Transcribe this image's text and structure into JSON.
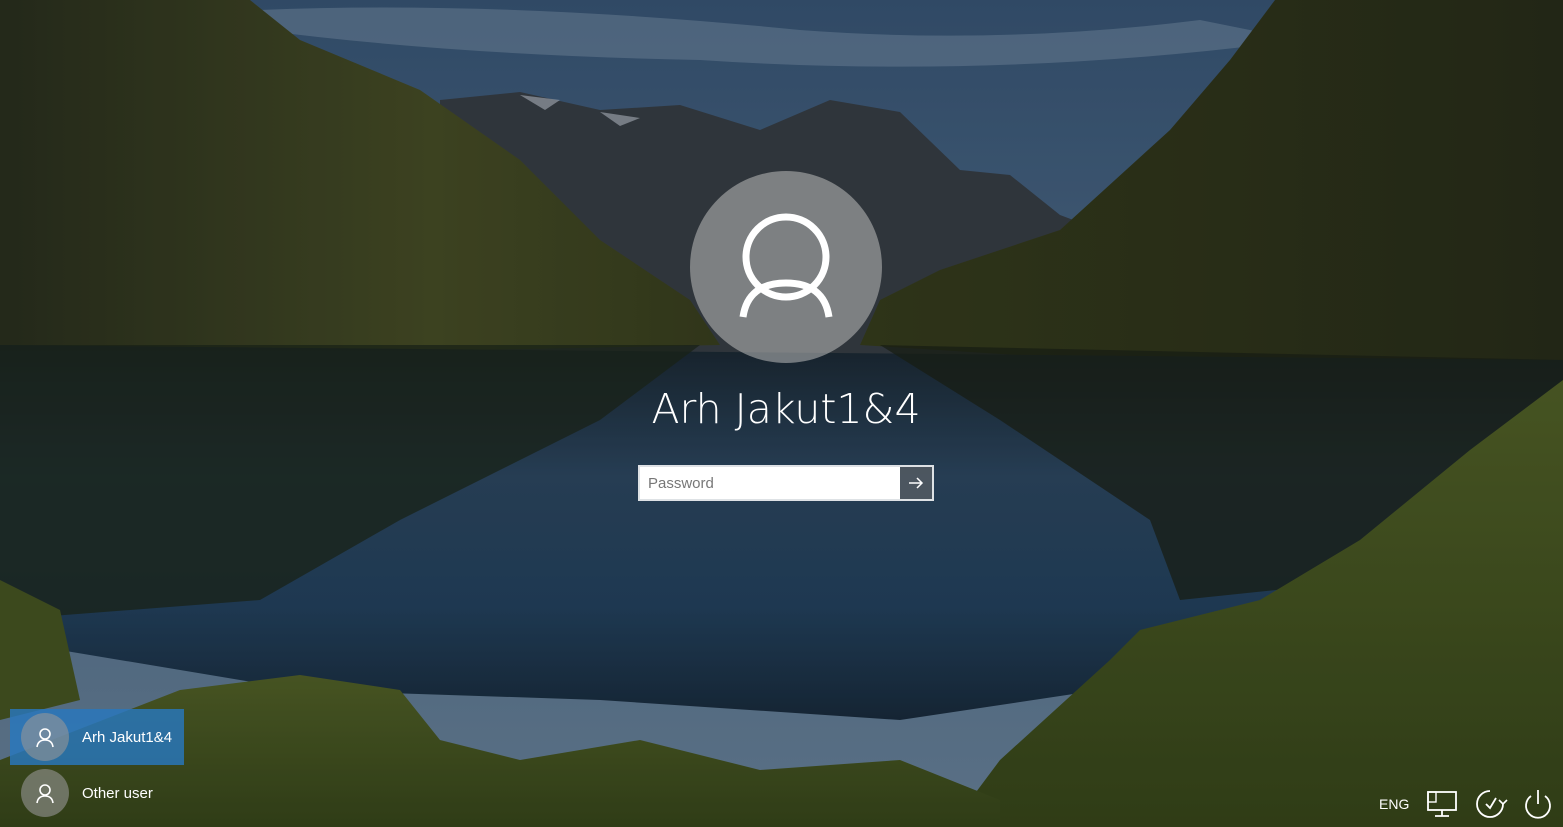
{
  "current_user": {
    "name": "Arh Jakut1&4",
    "avatar_icon": "user-icon"
  },
  "password": {
    "placeholder": "Password",
    "value": "",
    "submit_icon": "arrow-right-icon"
  },
  "user_list": [
    {
      "name": "Arh Jakut1&4",
      "selected": true,
      "icon": "user-icon"
    },
    {
      "name": "Other user",
      "selected": false,
      "icon": "user-icon"
    }
  ],
  "tray": {
    "language": "ENG",
    "network_icon": "network-icon",
    "accessibility_icon": "ease-of-access-icon",
    "power_icon": "power-icon"
  },
  "colors": {
    "selected_user_bg": "#2878be",
    "text": "#ffffff"
  }
}
